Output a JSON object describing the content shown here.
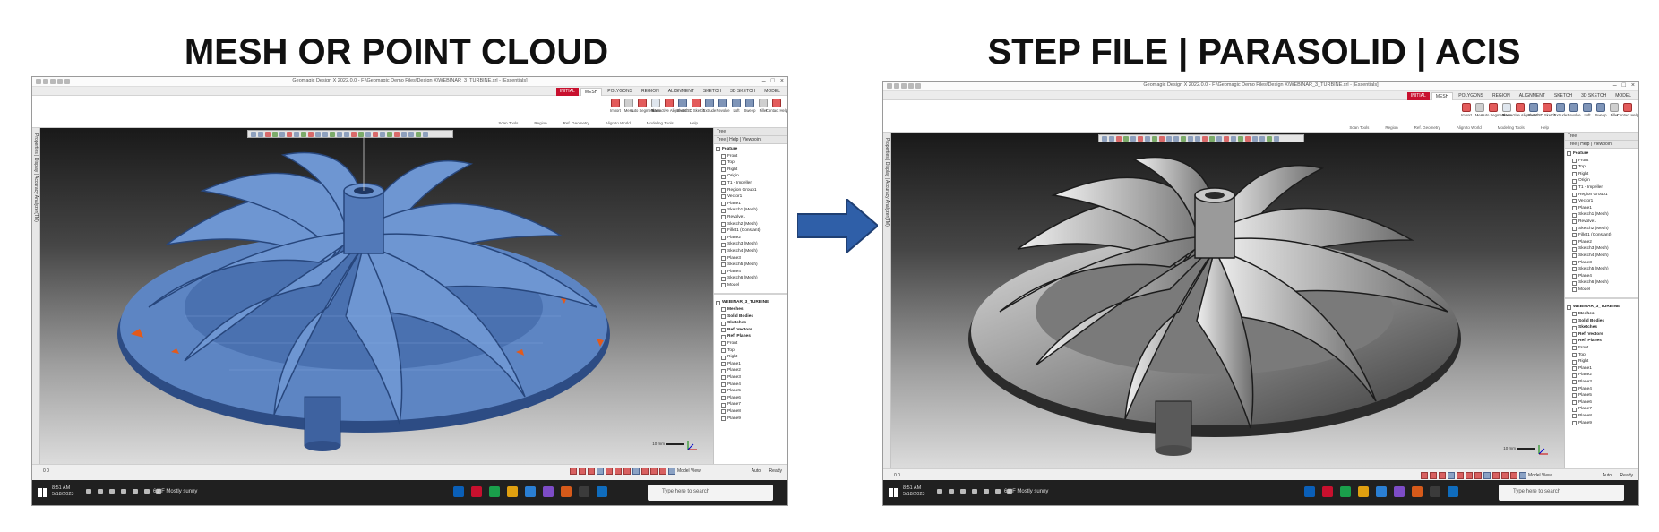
{
  "titles": {
    "left": "MESH OR POINT CLOUD",
    "right": "STEP FILE | PARASOLID | ACIS"
  },
  "colors": {
    "mesh_blue": "#5d85c3",
    "mesh_shadow": "#2d4c84",
    "solid_gray": "#8f8f8f",
    "solid_dark": "#2b2b2b",
    "accent_red": "#c8102e",
    "arrow_blue": "#2f5fa8"
  },
  "app": {
    "window_title": "Geomagic Design X 2022.0.0 - F:\\Geomagic Demo Files\\Design X\\WEBINAR_3_TURBINE.xrl - [Essentials]",
    "menu_tabs": [
      "INITIAL",
      "MESH",
      "POLYGONS",
      "REGION",
      "ALIGNMENT",
      "SKETCH",
      "3D SKETCH",
      "MODEL"
    ],
    "ribbon_groups": [
      "Scan Tools",
      "Region",
      "Ref. Geometry",
      "Align to World",
      "Modeling Tools",
      "Help"
    ],
    "ribbon_tools": [
      "Import",
      "Mesh",
      "Auto Segment",
      "Plane",
      "Interactive Alignment",
      "Sketch",
      "3D Sketch",
      "Extrude",
      "Revolve",
      "Loft",
      "Sweep",
      "Fillet",
      "Contact Help"
    ],
    "side_dock_label": "Properties | Display | Accuracy Analyzer(TM)",
    "panel_header": "Tree",
    "panel_tabs": "Tree | Help | Viewpoint",
    "feature_tree": [
      "Feature",
      "Front",
      "Top",
      "Right",
      "Origin",
      "T1 - Impeller",
      "Region Group1",
      "Vector1",
      "Plane1",
      "Sketch1 (Mesh)",
      "Revolve1",
      "Sketch2 (Mesh)",
      "Fillet1 (Constant)",
      "Plane2",
      "Sketch3 (Mesh)",
      "Sketch4 (Mesh)",
      "Plane3",
      "Sketch5 (Mesh)",
      "Plane4",
      "Sketch6 (Mesh)",
      "Model"
    ],
    "model_tree": [
      "WEBINAR_3_TURBINE",
      "Meshes",
      "Solid Bodies",
      "Sketches",
      "Ref. Vectors",
      "Ref. Planes",
      "Front",
      "Top",
      "Right",
      "Plane1",
      "Plane2",
      "Plane3",
      "Plane4",
      "Plane5",
      "Plane6",
      "Plane7",
      "Plane8",
      "Plane9"
    ],
    "scale_label": "10 mm",
    "model_view_label": "Model View",
    "auto_label": "Auto",
    "ready_label": "Ready",
    "page_info": "0  0",
    "taskbar": {
      "clock": "8:51 AM",
      "date": "5/18/2023",
      "weather": "61°F  Mostly sunny",
      "search_placeholder": "Type here to search"
    }
  }
}
